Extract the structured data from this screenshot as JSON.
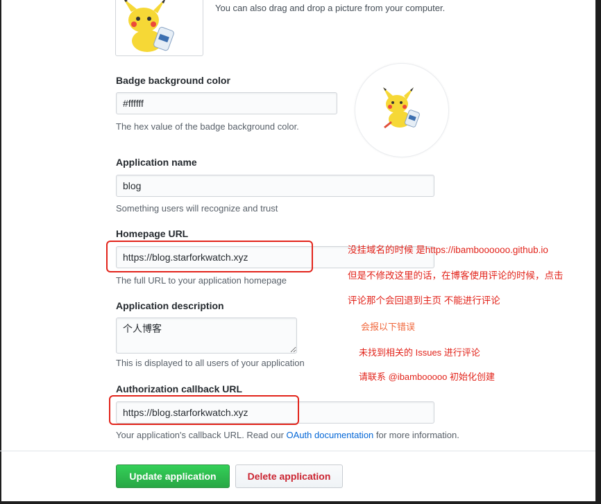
{
  "upload": {
    "drag_hint": "You can also drag and drop a picture from your computer."
  },
  "badge": {
    "label": "Badge background color",
    "value": "#ffffff",
    "hint": "The hex value of the badge background color."
  },
  "app_name": {
    "label": "Application name",
    "value": "blog",
    "hint": "Something users will recognize and trust"
  },
  "homepage": {
    "label": "Homepage URL",
    "value": "https://blog.starforkwatch.xyz",
    "hint": "The full URL to your application homepage"
  },
  "description": {
    "label": "Application description",
    "value": "个人博客",
    "hint": "This is displayed to all users of your application"
  },
  "callback": {
    "label": "Authorization callback URL",
    "value": "https://blog.starforkwatch.xyz",
    "hint_before": "Your application's callback URL. Read our ",
    "hint_link": "OAuth documentation",
    "hint_after": " for more information."
  },
  "buttons": {
    "update": "Update application",
    "delete": "Delete application"
  },
  "annotations": {
    "line1": "没挂域名的时候 是https://ibamboooooo.github.io",
    "line2": "但是不修改这里的话，在博客使用评论的时候，点击",
    "line3": "评论那个会回退到主页  不能进行评论",
    "line4": "会报以下错误",
    "line5": "未找到相关的 Issues 进行评论",
    "line6": "请联系 @ibambooooo 初始化创建"
  },
  "colors": {
    "annotation_red": "#e2231a",
    "annotation_orange": "#f0663a",
    "primary_green": "#28a745",
    "danger_red": "#cb2431",
    "link_blue": "#0366d6"
  }
}
